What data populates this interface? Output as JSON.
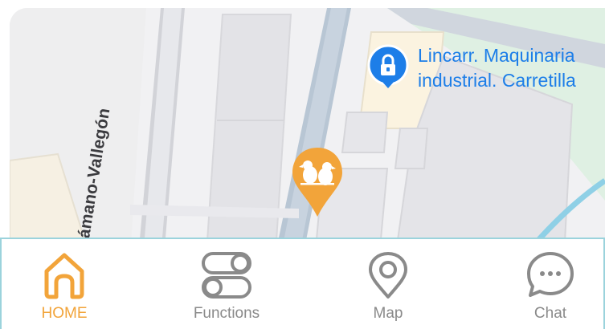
{
  "map": {
    "road_label": "Sámano-Vallegón",
    "poi": {
      "name_line1": "Lincarr. Maquinaria",
      "name_line2": "industrial. Carretilla",
      "icon": "lock-icon",
      "color": "#1d7ee8"
    },
    "marker": {
      "icon": "birds-marker-icon",
      "color": "#f2a43a"
    }
  },
  "nav": {
    "active_color": "#f2a43a",
    "inactive_color": "#8a8a8a",
    "items": [
      {
        "label": "HOME",
        "icon": "home-icon",
        "active": true
      },
      {
        "label": "Functions",
        "icon": "toggles-icon",
        "active": false
      },
      {
        "label": "Map",
        "icon": "map-pin-icon",
        "active": false
      },
      {
        "label": "Chat",
        "icon": "chat-bubble-icon",
        "active": false
      }
    ]
  }
}
